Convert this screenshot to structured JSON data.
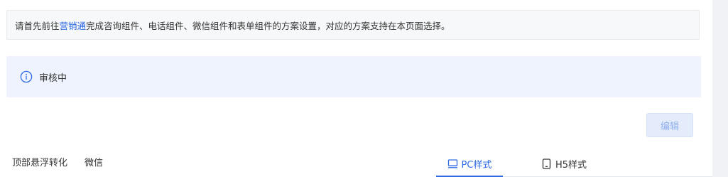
{
  "notice": {
    "prefix": "请首先前往",
    "link": "营销通",
    "suffix": "完成咨询组件、电话组件、微信组件和表单组件的方案设置，对应的方案支持在本页面选择。"
  },
  "status": {
    "icon": "info-icon",
    "text": "审核中"
  },
  "actions": {
    "edit_label": "编辑"
  },
  "conversion_tabs": [
    {
      "label": "顶部悬浮转化"
    },
    {
      "label": "微信"
    }
  ],
  "style_tabs": [
    {
      "label": "PC样式",
      "icon": "monitor-icon",
      "active": true
    },
    {
      "label": "H5样式",
      "icon": "mobile-icon",
      "active": false
    }
  ],
  "colors": {
    "accent": "#2d6ae3",
    "status_bg": "#eef3fd",
    "notice_bg": "#f7f8fa",
    "disabled_button_text": "#8fb0ee"
  }
}
